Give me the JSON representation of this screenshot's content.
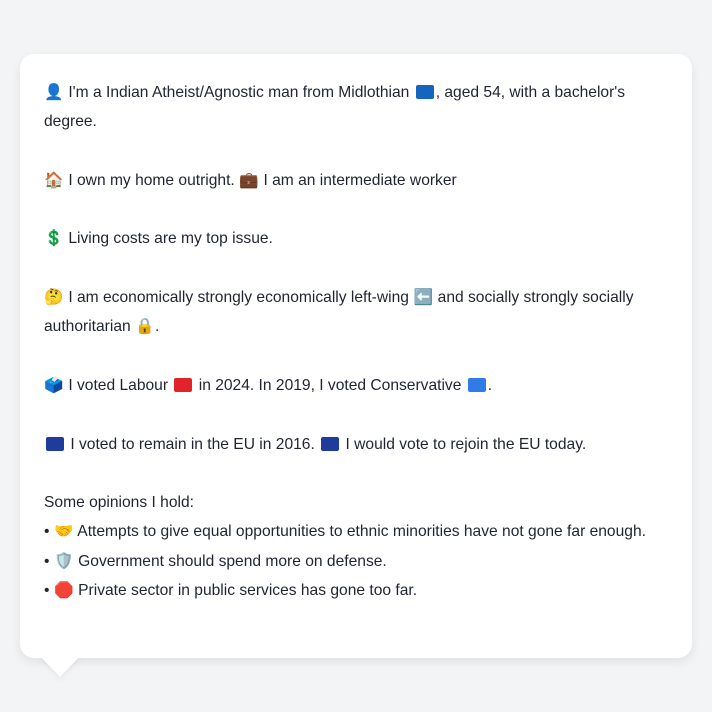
{
  "profile": {
    "identity": {
      "icon": "👤",
      "text": "I'm a Indian Atheist/Agnostic man from Midlothian",
      "flag": "🏴",
      "text2": ", aged 54, with a bachelor's degree."
    },
    "housing": {
      "icon": "🏠",
      "text": "I own my home outright.",
      "icon2": "💼",
      "text2": "I am an intermediate worker"
    },
    "issue": {
      "icon": "💲",
      "text": "Living costs are my top issue."
    },
    "ideology": {
      "icon": "🤔",
      "text": "I am economically strongly economically left-wing",
      "icon2": "⬅️",
      "text2": "and socially strongly socially authoritarian",
      "icon3": "🔒",
      "text3": "."
    },
    "votes": {
      "icon": "🗳️",
      "text": "I voted Labour",
      "text2": "in 2024. In 2019, I voted Conservative",
      "text3": ".",
      "labour_color": "#e0242a",
      "conservative_color": "#2f7be8"
    },
    "eu": {
      "icon": "🇪🇺",
      "text": "I voted to remain in the EU in 2016.",
      "icon2": "🇪🇺",
      "text2": "I would vote to rejoin the EU today.",
      "eu_color": "#1f3c9c"
    },
    "opinions": {
      "heading": "Some opinions I hold:",
      "items": [
        {
          "bullet": "•",
          "icon": "🤝",
          "text": "Attempts to give equal opportunities to ethnic minorities have not gone far enough."
        },
        {
          "bullet": "•",
          "icon": "🛡️",
          "text": "Government should spend more on defense."
        },
        {
          "bullet": "•",
          "icon": "🛑",
          "text": "Private sector in public services has gone too far."
        }
      ]
    }
  }
}
